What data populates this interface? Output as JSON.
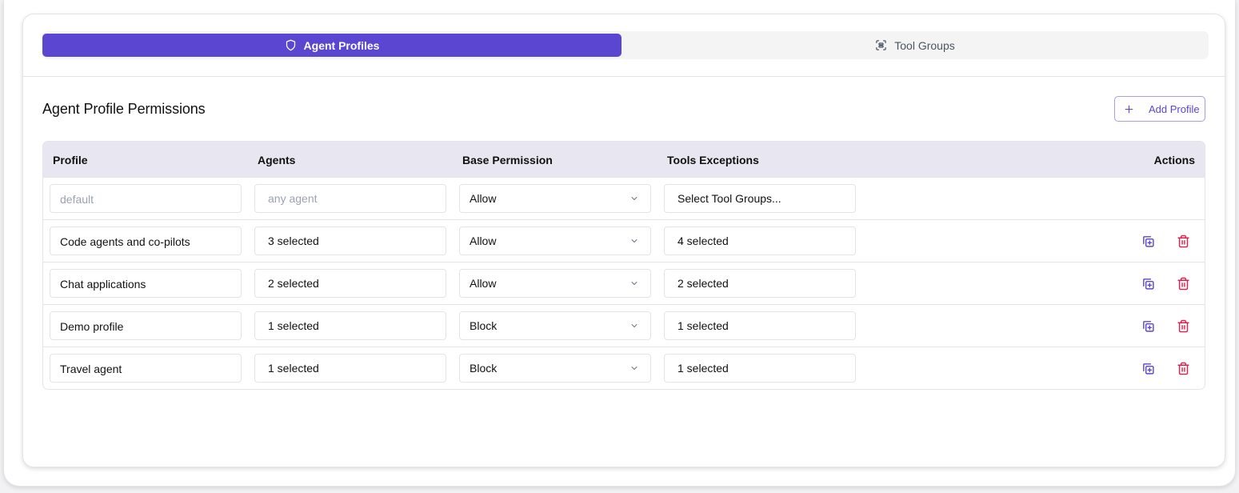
{
  "tabs": [
    {
      "label": "Agent Profiles",
      "icon": "shield-icon",
      "active": true
    },
    {
      "label": "Tool Groups",
      "icon": "scan-icon",
      "active": false
    }
  ],
  "section": {
    "title": "Agent Profile Permissions"
  },
  "add_button": {
    "label": "Add Profile",
    "icon": "plus-icon"
  },
  "table": {
    "headers": {
      "profile": "Profile",
      "agents": "Agents",
      "base_permission": "Base Permission",
      "tools_exceptions": "Tools Exceptions",
      "actions": "Actions"
    },
    "default_row": {
      "profile_placeholder": "default",
      "agents_placeholder": "any agent",
      "base_permission": "Allow",
      "tools_exceptions": "Select Tool Groups..."
    },
    "rows": [
      {
        "profile": "Code agents and co-pilots",
        "agents": "3 selected",
        "base_permission": "Allow",
        "tools_exceptions": "4 selected"
      },
      {
        "profile": "Chat applications",
        "agents": "2 selected",
        "base_permission": "Allow",
        "tools_exceptions": "2 selected"
      },
      {
        "profile": "Demo profile",
        "agents": "1 selected",
        "base_permission": "Block",
        "tools_exceptions": "1 selected"
      },
      {
        "profile": "Travel agent",
        "agents": "1 selected",
        "base_permission": "Block",
        "tools_exceptions": "1 selected"
      }
    ]
  },
  "colors": {
    "accent": "#5b46d2",
    "header_bg": "#e8e6f1",
    "danger": "#e11d48"
  }
}
